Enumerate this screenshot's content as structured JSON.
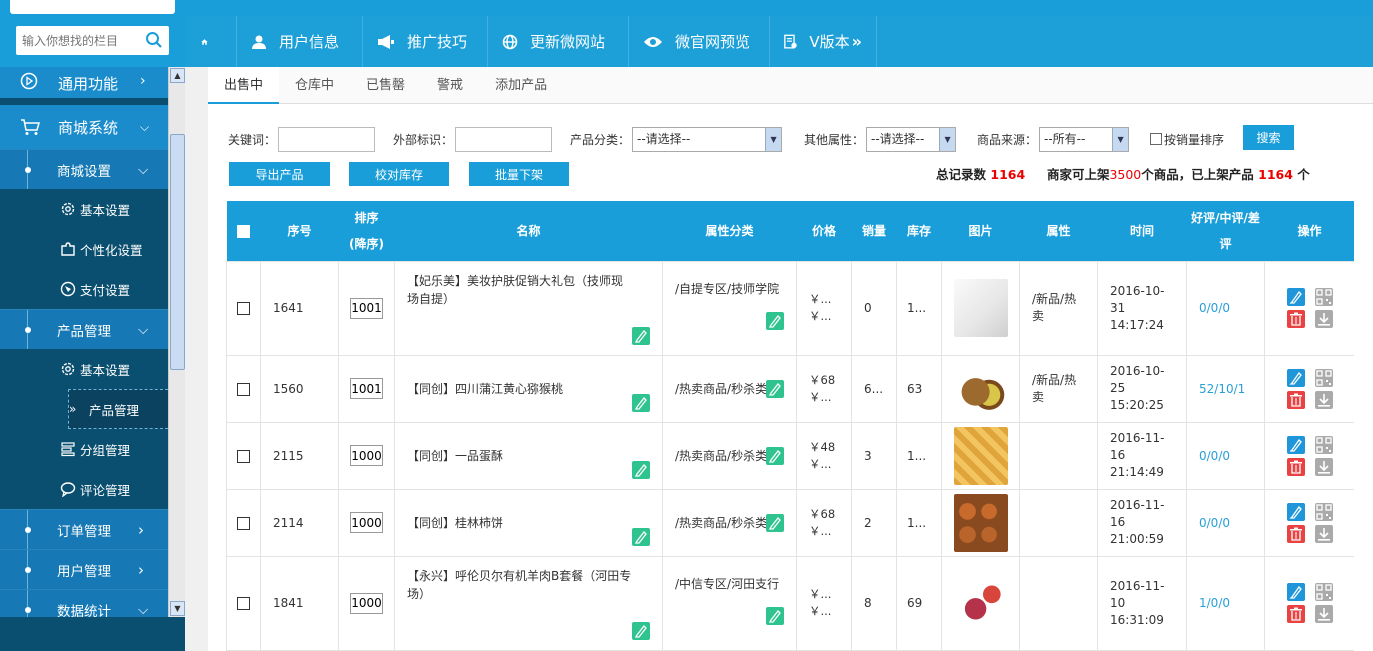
{
  "search": {
    "placeholder": "输入你想找的栏目"
  },
  "topnav": [
    {
      "label": "",
      "icon": "home-icon"
    },
    {
      "label": "用户信息",
      "icon": "user-icon"
    },
    {
      "label": "推广技巧",
      "icon": "megaphone-icon"
    },
    {
      "label": "更新微网站",
      "icon": "globe-icon"
    },
    {
      "label": "微官网预览",
      "icon": "eye-icon"
    },
    {
      "label": "V版本",
      "icon": "doc-gear-icon"
    }
  ],
  "sidebar": {
    "tongyong": "通用功能",
    "shangcheng": "商城系统",
    "shangcheng_shezhi": "商城设置",
    "jiben1": "基本设置",
    "gexinghua": "个性化设置",
    "zhifu": "支付设置",
    "chanpin_guanli": "产品管理",
    "jiben2": "基本设置",
    "chanpin_sub": "产品管理",
    "fenzu": "分组管理",
    "pinglun": "评论管理",
    "dingdan": "订单管理",
    "yonghu": "用户管理",
    "shuju": "数据统计"
  },
  "tabs": [
    "出售中",
    "仓库中",
    "已售罄",
    "警戒",
    "添加产品"
  ],
  "filters": {
    "keyword_label": "关键词：",
    "external_label": "外部标识：",
    "category_label": "产品分类：",
    "category_value": "--请选择--",
    "other_label": "其他属性：",
    "other_value": "--请选择--",
    "source_label": "商品来源：",
    "source_value": "--所有--",
    "sort_sales": "按销量排序",
    "search_btn": "搜索"
  },
  "actions": {
    "export": "导出产品",
    "check_stock": "校对库存",
    "batch_off": "批量下架"
  },
  "summary": {
    "total_label": "总记录数",
    "total": "1164",
    "p1": "商家可上架",
    "limit": "3500",
    "p2": "个商品，已上架产品",
    "listed": "1164",
    "p3": "个"
  },
  "table": {
    "headers": {
      "no": "序号",
      "sort": "排序(降序)",
      "name": "名称",
      "cat": "属性分类",
      "price": "价格",
      "sales": "销量",
      "stock": "库存",
      "img": "图片",
      "attr": "属性",
      "time": "时间",
      "rating": "好评/中评/差评",
      "ops": "操作"
    },
    "rows": [
      {
        "no": "1641",
        "sort": "1001",
        "name": "【妃乐美】美妆护肤促销大礼包（技师现场自提）",
        "cat": "/自提专区/技师学院",
        "price1": "￥...",
        "price2": "￥...",
        "sales": "0",
        "stock": "1...",
        "attr": "/新品/热卖",
        "time": "2016-10-31 14:17:24",
        "rating": "0/0/0",
        "img": "cosmetics"
      },
      {
        "no": "1560",
        "sort": "1001",
        "name": "【同创】四川蒲江黄心猕猴桃",
        "cat": "/热卖商品/秒杀类",
        "price1": "￥68",
        "price2": "￥...",
        "sales": "6...",
        "stock": "63",
        "attr": "/新品/热卖",
        "time": "2016-10-25 15:20:25",
        "rating": "52/10/1",
        "img": "kiwi"
      },
      {
        "no": "2115",
        "sort": "1000",
        "name": "【同创】一品蛋酥",
        "cat": "/热卖商品/秒杀类",
        "price1": "￥48",
        "price2": "￥...",
        "sales": "3",
        "stock": "1...",
        "attr": "",
        "time": "2016-11-16 21:14:49",
        "rating": "0/0/0",
        "img": "pastry"
      },
      {
        "no": "2114",
        "sort": "1000",
        "name": "【同创】桂林柿饼",
        "cat": "/热卖商品/秒杀类",
        "price1": "￥68",
        "price2": "￥...",
        "sales": "2",
        "stock": "1...",
        "attr": "",
        "time": "2016-11-16 21:00:59",
        "rating": "0/0/0",
        "img": "persimmon"
      },
      {
        "no": "1841",
        "sort": "1000",
        "name": "【永兴】呼伦贝尔有机羊肉B套餐（河田专场）",
        "cat": "/中信专区/河田支行",
        "price1": "￥...",
        "price2": "￥...",
        "sales": "8",
        "stock": "69",
        "attr": "",
        "time": "2016-11-10 16:31:09",
        "rating": "1/0/0",
        "img": "lamb"
      }
    ]
  },
  "colors": {
    "accent": "#1a9ed9",
    "red": "#e00",
    "sidebar": "#0a4f6f"
  }
}
